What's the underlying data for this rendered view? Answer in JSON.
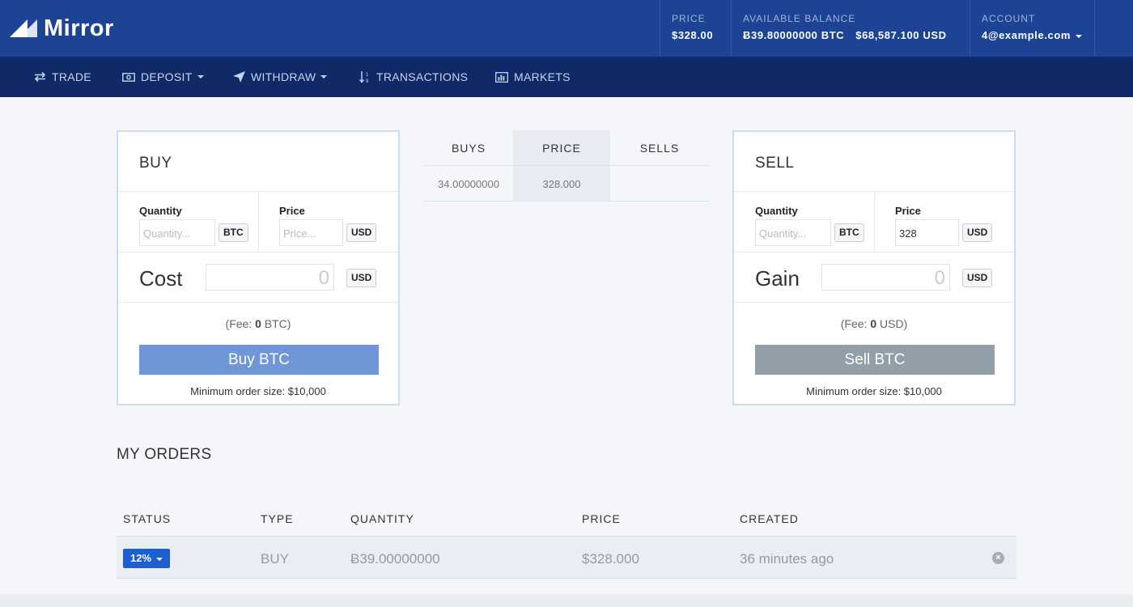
{
  "header": {
    "logo_text": "Mirror",
    "price_label": "PRICE",
    "price_value": "$328.00",
    "balance_label": "AVAILABLE BALANCE",
    "balance_btc": "Ƀ39.80000000 BTC",
    "balance_usd": "$68,587.100 USD",
    "account_label": "ACCOUNT",
    "account_value": "4@example.com"
  },
  "nav": {
    "trade": "TRADE",
    "deposit": "DEPOSIT",
    "withdraw": "WITHDRAW",
    "transactions": "TRANSACTIONS",
    "markets": "MARKETS"
  },
  "buy_panel": {
    "title": "BUY",
    "quantity_label": "Quantity",
    "quantity_placeholder": "Quantity...",
    "quantity_unit": "BTC",
    "price_label": "Price",
    "price_placeholder": "Price...",
    "price_unit": "USD",
    "cost_label": "Cost",
    "cost_value": "0",
    "cost_unit": "USD",
    "fee_prefix": "(Fee: ",
    "fee_value": "0",
    "fee_suffix": " BTC)",
    "button": "Buy BTC",
    "min_order": "Minimum order size: $10,000"
  },
  "sell_panel": {
    "title": "SELL",
    "quantity_label": "Quantity",
    "quantity_placeholder": "Quantity...",
    "quantity_unit": "BTC",
    "price_label": "Price",
    "price_value": "328",
    "price_unit": "USD",
    "gain_label": "Gain",
    "gain_value": "0",
    "gain_unit": "USD",
    "fee_prefix": "(Fee: ",
    "fee_value": "0",
    "fee_suffix": " USD)",
    "button": "Sell BTC",
    "min_order": "Minimum order size: $10,000"
  },
  "order_book": {
    "headers": {
      "buys": "BUYS",
      "price": "PRICE",
      "sells": "SELLS"
    },
    "rows": [
      {
        "buys": "34.00000000",
        "price": "328.000",
        "sells": ""
      }
    ]
  },
  "my_orders": {
    "title": "MY ORDERS",
    "headers": {
      "status": "STATUS",
      "type": "TYPE",
      "quantity": "QUANTITY",
      "price": "PRICE",
      "created": "CREATED"
    },
    "rows": [
      {
        "status": "12%",
        "type": "BUY",
        "quantity": "Ƀ39.00000000",
        "price": "$328.000",
        "created": "36 minutes ago"
      }
    ]
  },
  "colors": {
    "header_bg": "#1d4494",
    "nav_bg": "#0f2a66",
    "buy_button": "#6f97d8",
    "sell_button": "#929ea8",
    "status_badge": "#1d5fcf"
  }
}
